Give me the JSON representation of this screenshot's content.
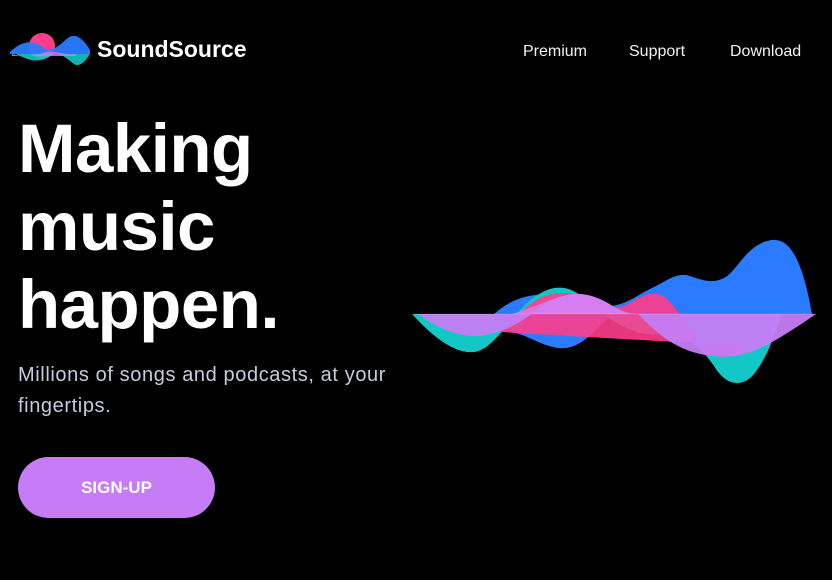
{
  "brand": {
    "name": "SoundSource",
    "colors": {
      "pink": "#ff3d8b",
      "blue": "#2a7bff",
      "teal": "#14c7c7",
      "purple": "#c57cf4"
    }
  },
  "nav": {
    "items": [
      "Premium",
      "Support",
      "Download"
    ]
  },
  "hero": {
    "headline_lines": [
      "Making",
      "music",
      "happen."
    ],
    "subtitle": "Millions of songs and podcasts, at your fingertips.",
    "cta_label": "SIGN-UP"
  },
  "illustration": {
    "icon": "sound-wave-graphic"
  }
}
